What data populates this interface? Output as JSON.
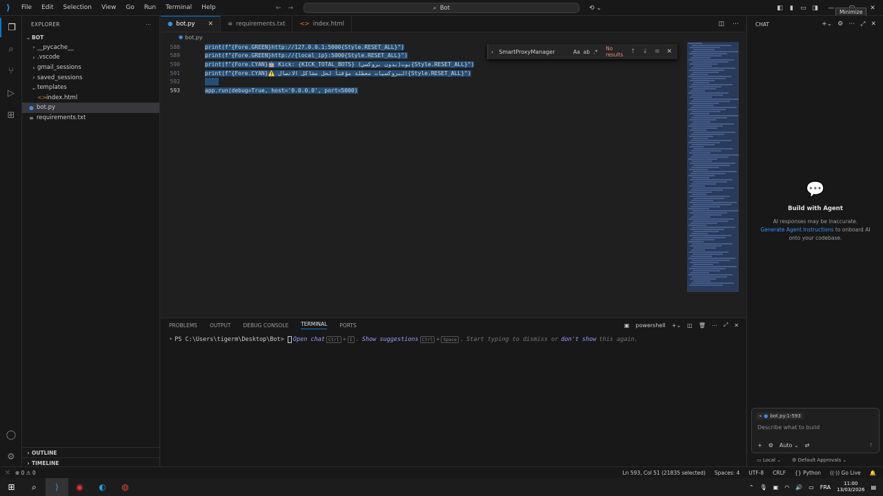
{
  "titlebar": {
    "menu": [
      "File",
      "Edit",
      "Selection",
      "View",
      "Go",
      "Run",
      "Terminal",
      "Help"
    ],
    "search_text": "Bot",
    "tooltip": "Minimize"
  },
  "sidebar": {
    "title": "EXPLORER",
    "root": "BOT",
    "items": [
      {
        "label": "__pycache__",
        "type": "folder",
        "open": false,
        "indent": 1
      },
      {
        "label": ".vscode",
        "type": "folder",
        "open": false,
        "indent": 1
      },
      {
        "label": "gmail_sessions",
        "type": "folder",
        "open": false,
        "indent": 1
      },
      {
        "label": "saved_sessions",
        "type": "folder",
        "open": false,
        "indent": 1
      },
      {
        "label": "templates",
        "type": "folder",
        "open": true,
        "indent": 1
      },
      {
        "label": "index.html",
        "type": "html",
        "indent": 2
      },
      {
        "label": "bot.py",
        "type": "py",
        "indent": 1,
        "selected": true
      },
      {
        "label": "requirements.txt",
        "type": "txt",
        "indent": 1
      }
    ],
    "outline": "OUTLINE",
    "timeline": "TIMELINE"
  },
  "editor": {
    "tabs": [
      {
        "label": "bot.py",
        "active": true
      },
      {
        "label": "requirements.txt",
        "active": false
      },
      {
        "label": "index.html",
        "active": false
      }
    ],
    "breadcrumb": "bot.py",
    "find": {
      "query": "SmartProxyManager",
      "opt_case": "Aa",
      "opt_word": "ab",
      "opt_regex": ".*",
      "result": "No results"
    },
    "lines": [
      {
        "num": "588",
        "code": "print(f\"{Fore.GREEN}http://127.0.0.1:5000{Style.RESET_ALL}\")"
      },
      {
        "num": "589",
        "code": "print(f\"{Fore.GREEN}http://{local_ip}:5000{Style.RESET_ALL}\")"
      },
      {
        "num": "590",
        "code": "print(f\"{Fore.CYAN}🤖 Kick: {KICK_TOTAL_BOTS} (بدون بروكسي)بوت{Style.RESET_ALL}\")"
      },
      {
        "num": "591",
        "code": "print(f\"{Fore.CYAN}⚠️ البروكسيات معطلة مؤقتاً لحل مشاكل الاتصال{Style.RESET_ALL}\")"
      },
      {
        "num": "592",
        "code": ""
      },
      {
        "num": "593",
        "code": "app.run(debug=True, host='0.0.0.0', port=5000)"
      }
    ]
  },
  "panel": {
    "tabs": [
      "PROBLEMS",
      "OUTPUT",
      "DEBUG CONSOLE",
      "TERMINAL",
      "PORTS"
    ],
    "active_tab": "TERMINAL",
    "shell": "powershell",
    "prompt": "PS C:\\Users\\tigerm\\Desktop\\Bot> ",
    "hint_open_chat": "Open chat",
    "hint_key1": "Ctrl",
    "hint_plus1": "+",
    "hint_key2": "I",
    "hint_sep1": ".",
    "hint_show": "Show suggestions",
    "hint_key3": "Ctrl",
    "hint_plus2": "+",
    "hint_key4": "Space",
    "hint_sep2": ".",
    "hint_rest": "Start typing to dismiss or",
    "hint_dont": "don't show",
    "hint_end": "this again."
  },
  "chat": {
    "title": "CHAT",
    "agent_title": "Build with Agent",
    "disclaimer": "AI responses may be inaccurate.",
    "link": "Generate Agent Instructions",
    "link_tail_1": "to onboard AI",
    "link_tail_2": "onto your codebase.",
    "context": "bot.py:1-593",
    "placeholder": "Describe what to build",
    "mode": "Auto",
    "foot_local": "Local",
    "foot_approvals": "Default Approvals"
  },
  "statusbar": {
    "errors": "0",
    "warnings": "0",
    "position": "Ln 593, Col 51 (21835 selected)",
    "spaces": "Spaces: 4",
    "encoding": "UTF-8",
    "eol": "CRLF",
    "language": "Python",
    "golive": "Go Live"
  },
  "taskbar": {
    "lang": "FRA",
    "time": "11:00",
    "date": "13/03/2026"
  },
  "colors": {
    "accent": "#0078d4",
    "selection": "#264f78",
    "string": "#ce9178",
    "variable": "#9cdcfe",
    "keyword": "#569cd6"
  }
}
